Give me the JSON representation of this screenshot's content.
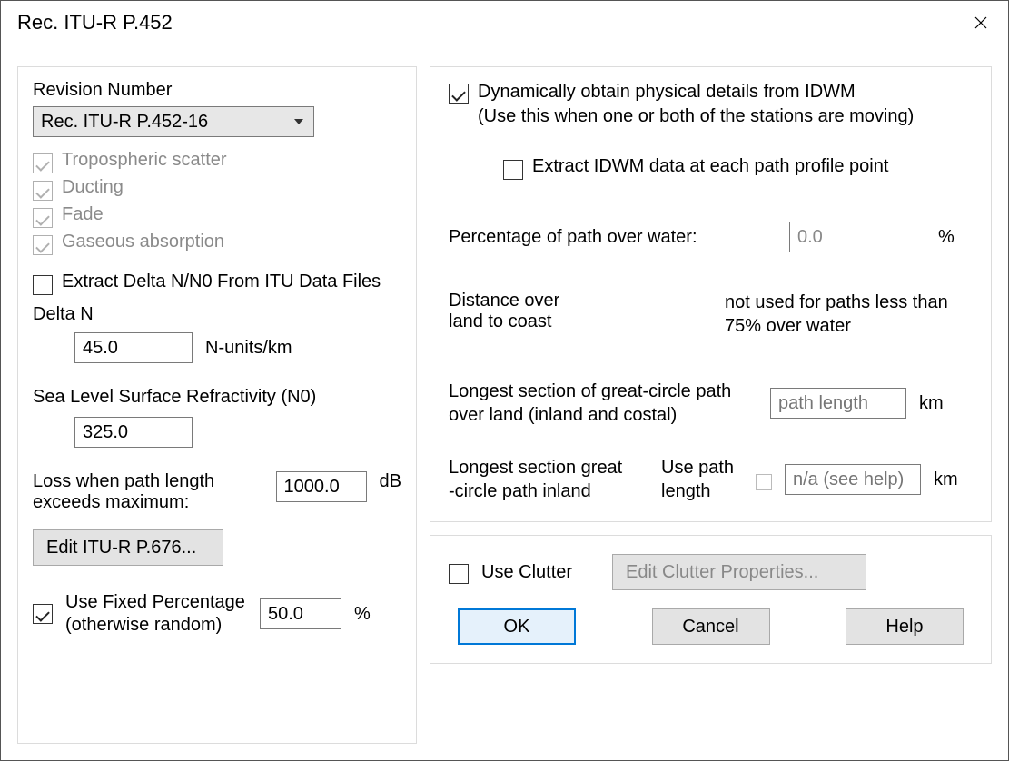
{
  "window": {
    "title": "Rec. ITU-R P.452"
  },
  "left": {
    "revision_label": "Revision Number",
    "revision_value": "Rec. ITU-R P.452-16",
    "opt_tropo": "Tropospheric scatter",
    "opt_ducting": "Ducting",
    "opt_fade": "Fade",
    "opt_gaseous": "Gaseous absorption",
    "extract_delta_label": "Extract Delta N/N0 From ITU Data Files",
    "delta_n_label": "Delta N",
    "delta_n_value": "45.0",
    "delta_n_unit": "N-units/km",
    "n0_label": "Sea Level Surface Refractivity (N0)",
    "n0_value": "325.0",
    "loss_label": "Loss when path length exceeds maximum:",
    "loss_value": "1000.0",
    "loss_unit": "dB",
    "edit_p676_label": "Edit ITU-R P.676...",
    "use_fixed_label": "Use Fixed Percentage (otherwise random)",
    "fixed_value": "50.0",
    "fixed_unit": "%"
  },
  "right": {
    "dynamic_label": "Dynamically obtain physical details from IDWM\n(Use this when one or both of the stations are moving)",
    "extract_idwm_label": "Extract IDWM data at each path profile point",
    "pct_water_label": "Percentage of path over water:",
    "pct_water_value": "0.0",
    "pct_water_unit": "%",
    "dist_land_label": "Distance over\nland to coast",
    "dist_land_note": "not used for paths less than 75% over water",
    "longest_land_label": "Longest section of great-circle path over land (inland and costal)",
    "longest_land_placeholder": "path length",
    "longest_land_unit": "km",
    "longest_inland_label": "Longest section great\n-circle path inland",
    "use_path_len_label": "Use path\nlength",
    "longest_inland_placeholder": "n/a (see help)",
    "longest_inland_unit": "km"
  },
  "clutter": {
    "use_clutter_label": "Use Clutter",
    "edit_clutter_label": "Edit Clutter Properties..."
  },
  "buttons": {
    "ok": "OK",
    "cancel": "Cancel",
    "help": "Help"
  }
}
